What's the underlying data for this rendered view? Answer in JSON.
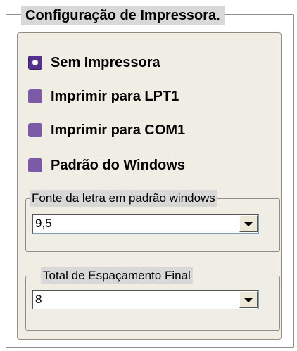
{
  "title": "Configuração de Impressora.",
  "radios": [
    {
      "label": "Sem Impressora",
      "checked": true
    },
    {
      "label": "Imprimir para LPT1",
      "checked": false
    },
    {
      "label": "Imprimir para COM1",
      "checked": false
    },
    {
      "label": "Padrão do Windows",
      "checked": false
    }
  ],
  "font_group": {
    "legend": "Fonte da letra em  padrão windows",
    "value": "9,5"
  },
  "spacing_group": {
    "legend": "Total de Espaçamento Final",
    "value": "8"
  },
  "colors": {
    "radio": "#7b5aa6",
    "panel_bg": "#f0eee4",
    "legend_bg": "#d8d8d8"
  }
}
